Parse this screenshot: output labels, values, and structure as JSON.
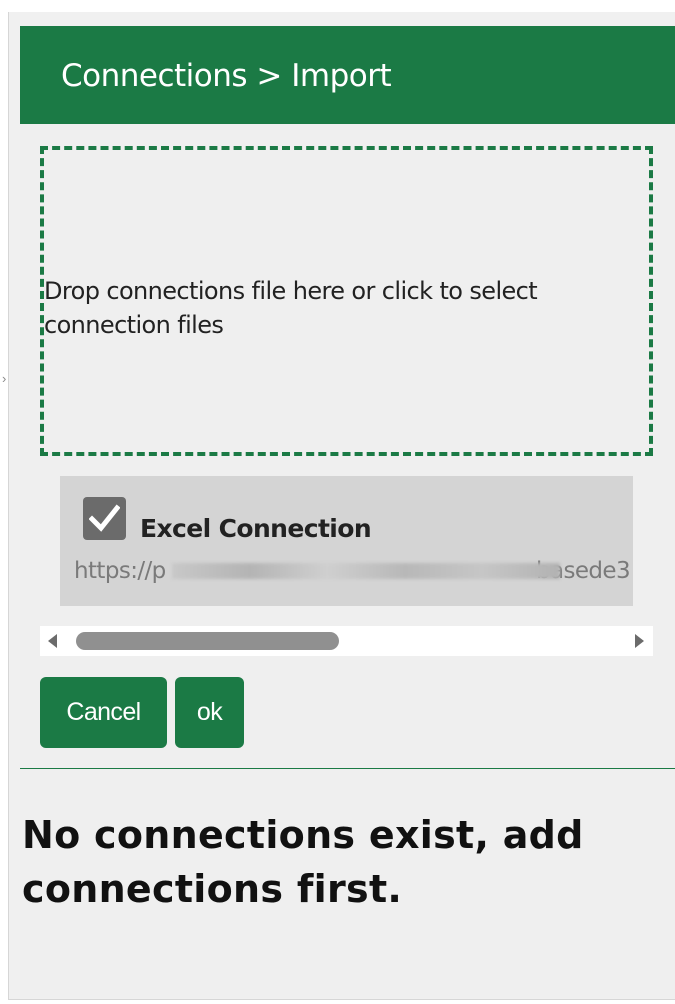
{
  "header": {
    "title": "Connections > Import"
  },
  "dropzone": {
    "text": "Drop connections file here or click to select connection files"
  },
  "file_list": {
    "items": [
      {
        "checked": true,
        "name": "Excel Connection",
        "url_prefix": "https://p",
        "url_suffix": "basede3"
      }
    ]
  },
  "scrollbar": {
    "position": 0.0
  },
  "actions": {
    "cancel_label": "Cancel",
    "ok_label": "ok"
  },
  "empty_state": {
    "message": "No connections exist, add connections first."
  },
  "colors": {
    "brand": "#1b7a45",
    "panel_bg": "#efefef",
    "card_bg": "#d4d4d4"
  },
  "icons": {
    "checkbox": "checkmark-icon",
    "scroll_left": "triangle-left-icon",
    "scroll_right": "triangle-right-icon"
  }
}
